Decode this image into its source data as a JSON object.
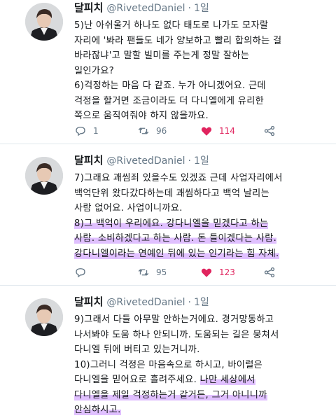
{
  "tweets": [
    {
      "name": "달피치",
      "handle": "@RivetedDaniel",
      "dot": "·",
      "time": "1일",
      "lines": [
        {
          "segments": [
            {
              "text": "5)난 아쉬울거 하나도 없다 태도로 나가도 모자랄",
              "hl": false
            }
          ]
        },
        {
          "segments": [
            {
              "text": "자리에 '봐라 팬들도 네가 양보하고 빨리 합의하는 걸",
              "hl": false
            }
          ]
        },
        {
          "segments": [
            {
              "text": "바라잖냐'고 말할 빌미를 주는게 정말 잘하는",
              "hl": false
            }
          ]
        },
        {
          "segments": [
            {
              "text": "일인가요?",
              "hl": false
            }
          ]
        },
        {
          "segments": [
            {
              "text": "6)걱정하는 마음 다 같죠. 누가 아니겠어요. 근데",
              "hl": false
            }
          ]
        },
        {
          "segments": [
            {
              "text": "걱정을 할거면 조금이라도 더 다니엘에게 유리한",
              "hl": false
            }
          ]
        },
        {
          "segments": [
            {
              "text": "쪽으로 움직여줘야 하지 않을까요.",
              "hl": false
            }
          ]
        }
      ],
      "reply_count": "1",
      "retweet_count": "96",
      "like_count": "114"
    },
    {
      "name": "달피치",
      "handle": "@RivetedDaniel",
      "dot": "·",
      "time": "1일",
      "lines": [
        {
          "segments": [
            {
              "text": "7)그래요 괘씸죄 있을수도 있겠죠 근데 사업자리에서",
              "hl": false
            }
          ]
        },
        {
          "segments": [
            {
              "text": "백억단위 왔다갔다하는데 괘씸하다고 백억 날리는",
              "hl": false
            }
          ]
        },
        {
          "segments": [
            {
              "text": "사람 없어요. 사업이니까요.",
              "hl": false
            }
          ]
        },
        {
          "segments": [
            {
              "text": "8)그 백억이 우리에요. 강다니엘을 믿겠다고 하는",
              "hl": true
            }
          ]
        },
        {
          "segments": [
            {
              "text": "사람. 소비하겠다고 하는 사람. 돈 들이겠다는 사람.",
              "hl": true
            }
          ]
        },
        {
          "segments": [
            {
              "text": "강다니엘이라는 연예인 뒤에 있는 인기라는 힘 자체.",
              "hl": true
            }
          ]
        }
      ],
      "reply_count": "",
      "retweet_count": "95",
      "like_count": "123"
    },
    {
      "name": "달피치",
      "handle": "@RivetedDaniel",
      "dot": "·",
      "time": "1일",
      "lines": [
        {
          "segments": [
            {
              "text": "9)그래서 다들 아무말 안하는거에요. 경거망동하고",
              "hl": false
            }
          ]
        },
        {
          "segments": [
            {
              "text": "나서봐야 도움 하나 안되니까. 도움되는 길은 뭉쳐서",
              "hl": false
            }
          ]
        },
        {
          "segments": [
            {
              "text": "다니엘 뒤에 버티고 있는거니까.",
              "hl": false
            }
          ]
        },
        {
          "segments": [
            {
              "text": "10)그러니 걱정은 마음속으로 하시고, 바이럴은",
              "hl": false
            }
          ]
        },
        {
          "segments": [
            {
              "text": "다니엘을 믿어요로 흘려주세요. ",
              "hl": false
            },
            {
              "text": "나만 세상에서",
              "hl": true
            }
          ]
        },
        {
          "segments": [
            {
              "text": "다니엘을 제일 걱정하는거 같거든, 그거 아니니까",
              "hl": true
            }
          ]
        },
        {
          "segments": [
            {
              "text": "안심하시고.",
              "hl": true
            }
          ]
        }
      ],
      "reply_count": "",
      "retweet_count": "",
      "like_count": ""
    }
  ],
  "icons": {
    "reply": "reply-icon",
    "retweet": "retweet-icon",
    "like": "heart-icon",
    "share": "share-icon"
  },
  "colors": {
    "text": "#14171a",
    "muted": "#657786",
    "like": "#e0245e",
    "highlight": "#c78cff"
  }
}
